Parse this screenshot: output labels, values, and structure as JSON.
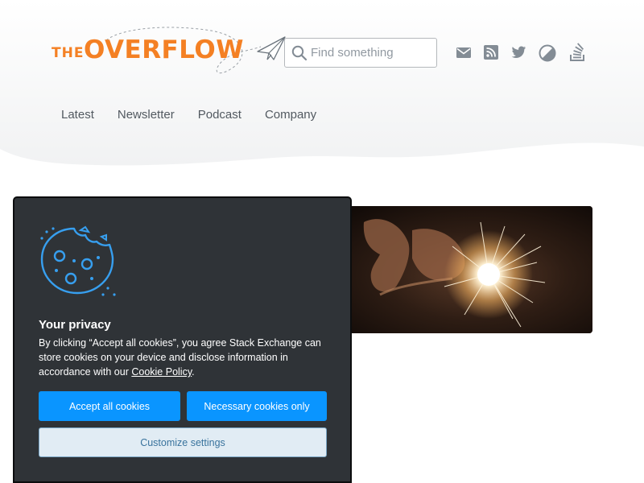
{
  "logo": {
    "prefix": "THE",
    "name": "OVERFLOW"
  },
  "search": {
    "placeholder": "Find something"
  },
  "social": [
    "email-icon",
    "rss-icon",
    "twitter-icon",
    "stack-exchange-icon",
    "stack-overflow-icon"
  ],
  "nav": {
    "items": [
      {
        "label": "Latest"
      },
      {
        "label": "Newsletter"
      },
      {
        "label": "Podcast"
      },
      {
        "label": "Company"
      }
    ]
  },
  "hero": {
    "image": "hands-holding-sparkler-photo"
  },
  "cookie": {
    "title": "Your privacy",
    "body_before_link": "By clicking “Accept all cookies”, you agree Stack Exchange can store cookies on your device and disclose information in accordance with our ",
    "link": "Cookie Policy",
    "body_after_link": ".",
    "accept_label": "Accept all cookies",
    "necessary_label": "Necessary cookies only",
    "customize_label": "Customize settings"
  },
  "colors": {
    "brand_orange": "#f48024",
    "primary_blue": "#0a95ff",
    "dialog_bg": "#2f3337",
    "nav_text": "#525960"
  }
}
